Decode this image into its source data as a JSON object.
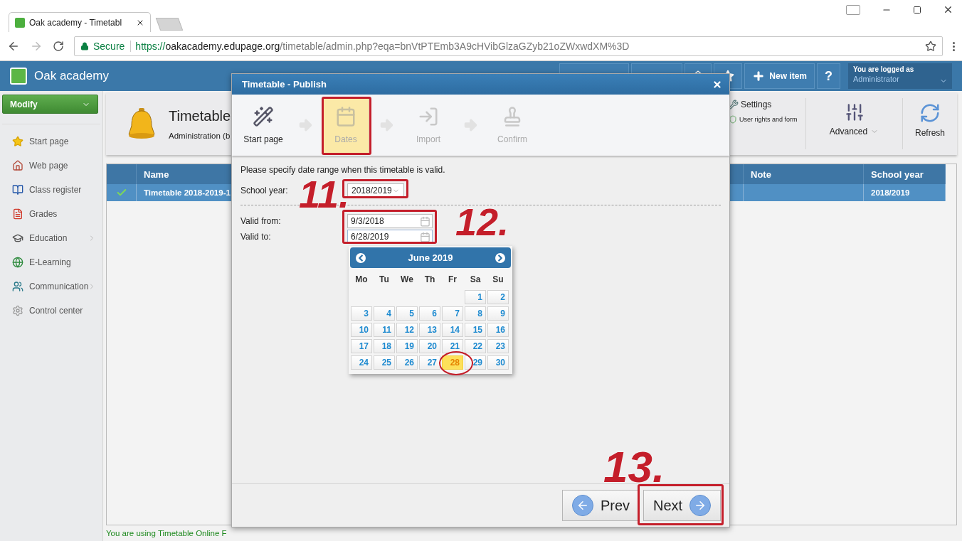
{
  "browser": {
    "tab": {
      "title": "Oak academy - Timetabl"
    },
    "address": {
      "secure_label": "Secure",
      "scheme": "https://",
      "host": "oakacademy.edupage.org",
      "path": "/timetable/admin.php?eqa=bnVtPTEmb3A9cHVibGlzaGZyb21oZWxwdXM%3D"
    }
  },
  "app": {
    "name": "Oak academy",
    "header_buttons": [
      {
        "kind": "icon"
      },
      {
        "kind": "icon"
      },
      {
        "kind": "icon"
      },
      {
        "kind": "icon"
      },
      {
        "kind": "labeled",
        "label": "New item"
      },
      {
        "kind": "glyph",
        "label": "?"
      }
    ],
    "user": {
      "caption": "You are logged as",
      "name": "Administrator"
    }
  },
  "sidebar": {
    "menu_button": "Modify",
    "items": [
      {
        "label": "Start page",
        "has_submenu": false
      },
      {
        "label": "Web page",
        "has_submenu": false
      },
      {
        "label": "Class register",
        "has_submenu": false
      },
      {
        "label": "Grades",
        "has_submenu": false
      },
      {
        "label": "Education",
        "has_submenu": true
      },
      {
        "label": "E-Learning",
        "has_submenu": false
      },
      {
        "label": "Communication",
        "has_submenu": true
      },
      {
        "label": "Control center",
        "has_submenu": false
      }
    ]
  },
  "toolbar": {
    "title": "Timetable",
    "subtitle": "Administration (b",
    "settings": "Settings",
    "user_rights": "User rights and form",
    "advanced": "Advanced",
    "refresh": "Refresh"
  },
  "table": {
    "columns": [
      "Name",
      "Note",
      "School year"
    ],
    "rows": [
      {
        "selected": true,
        "checked": true,
        "name": "Timetable 2018-2019-1",
        "school_year": "2018/2019"
      }
    ]
  },
  "footer_note": "You are using Timetable Online F",
  "dialog": {
    "title": "Timetable - Publish",
    "steps": [
      {
        "label": "Start page",
        "selected": false,
        "disabled": false
      },
      {
        "label": "Dates",
        "selected": true,
        "disabled": false
      },
      {
        "label": "Import",
        "selected": false,
        "disabled": true
      },
      {
        "label": "Confirm",
        "selected": false,
        "disabled": true
      }
    ],
    "instruction": "Please specify date range when this timetable is valid.",
    "school_year": {
      "label": "School year:",
      "value": "2018/2019"
    },
    "valid_from": {
      "label": "Valid from:",
      "value": "9/3/2018"
    },
    "valid_to": {
      "label": "Valid to:",
      "value": "6/28/2019"
    },
    "calendar": {
      "month": "June 2019",
      "weekdays": [
        "Mo",
        "Tu",
        "We",
        "Th",
        "Fr",
        "Sa",
        "Su"
      ],
      "weeks": [
        [
          {
            "day": "1",
            "selected": false
          },
          {
            "day": "2",
            "selected": false
          }
        ],
        [
          {
            "day": "3",
            "selected": false
          },
          {
            "day": "4",
            "selected": false
          },
          {
            "day": "5",
            "selected": false
          },
          {
            "day": "6",
            "selected": false
          },
          {
            "day": "7",
            "selected": false
          },
          {
            "day": "8",
            "selected": false
          },
          {
            "day": "9",
            "selected": false
          }
        ],
        [
          {
            "day": "10",
            "selected": false
          },
          {
            "day": "11",
            "selected": false
          },
          {
            "day": "12",
            "selected": false
          },
          {
            "day": "13",
            "selected": false
          },
          {
            "day": "14",
            "selected": false
          },
          {
            "day": "15",
            "selected": false
          },
          {
            "day": "16",
            "selected": false
          }
        ],
        [
          {
            "day": "17",
            "selected": false
          },
          {
            "day": "18",
            "selected": false
          },
          {
            "day": "19",
            "selected": false
          },
          {
            "day": "20",
            "selected": false
          },
          {
            "day": "21",
            "selected": false
          },
          {
            "day": "22",
            "selected": false
          },
          {
            "day": "23",
            "selected": false
          }
        ],
        [
          {
            "day": "24",
            "selected": false
          },
          {
            "day": "25",
            "selected": false
          },
          {
            "day": "26",
            "selected": false
          },
          {
            "day": "27",
            "selected": false
          },
          {
            "day": "28",
            "selected": true
          },
          {
            "day": "29",
            "selected": false
          },
          {
            "day": "30",
            "selected": false
          }
        ]
      ]
    },
    "buttons": {
      "prev": "Prev",
      "next": "Next"
    }
  },
  "annotations": [
    "11.",
    "12.",
    "13."
  ]
}
